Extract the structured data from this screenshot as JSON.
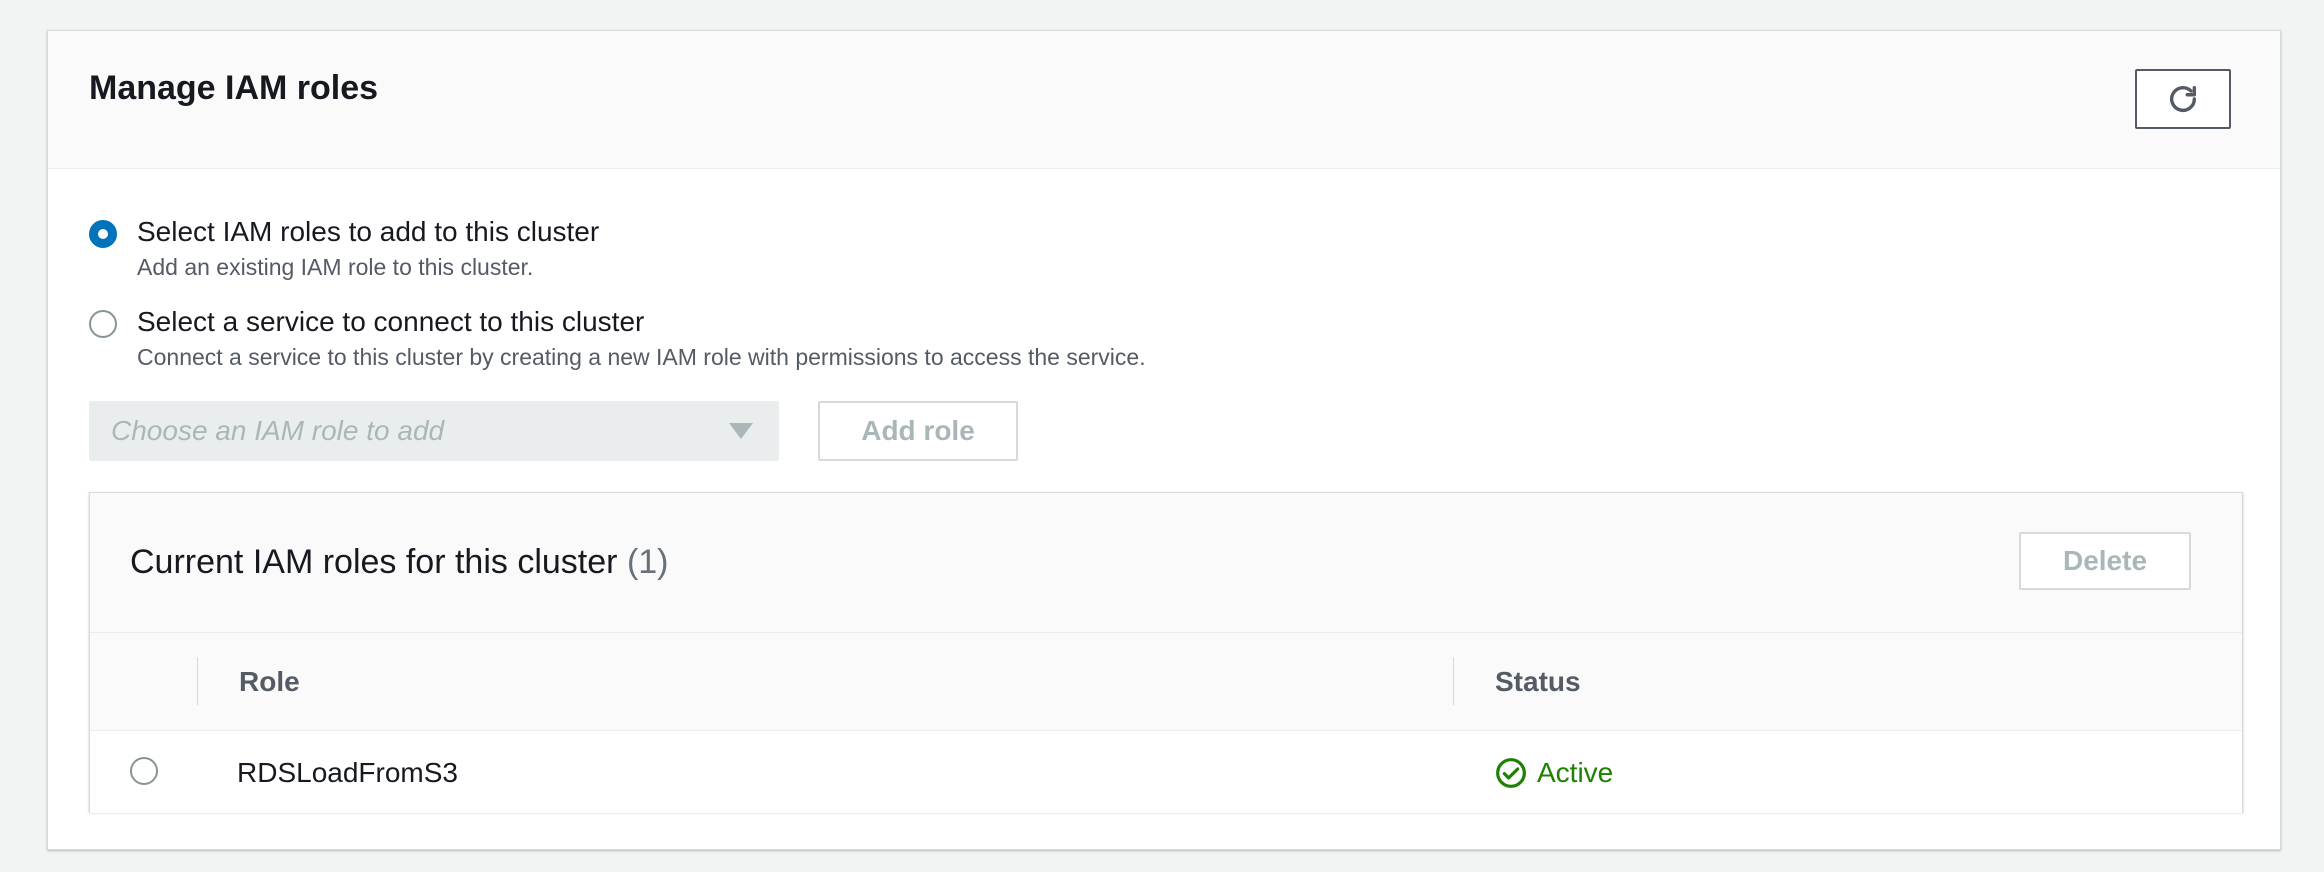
{
  "panel": {
    "title": "Manage IAM roles",
    "refresh_icon": "refresh-icon"
  },
  "options": [
    {
      "label": "Select IAM roles to add to this cluster",
      "description": "Add an existing IAM role to this cluster.",
      "selected": true
    },
    {
      "label": "Select a service to connect to this cluster",
      "description": "Connect a service to this cluster by creating a new IAM role with permissions to access the service.",
      "selected": false
    }
  ],
  "role_select": {
    "placeholder": "Choose an IAM role to add"
  },
  "add_role_button": "Add role",
  "current_roles": {
    "title": "Current IAM roles for this cluster",
    "count": "(1)",
    "delete_button": "Delete",
    "columns": [
      "Role",
      "Status"
    ],
    "rows": [
      {
        "role": "RDSLoadFromS3",
        "status": "Active",
        "status_icon": "check-circle-icon"
      }
    ]
  },
  "colors": {
    "accent": "#0073bb",
    "success": "#1d8102",
    "disabled_text": "#aab7b8"
  }
}
